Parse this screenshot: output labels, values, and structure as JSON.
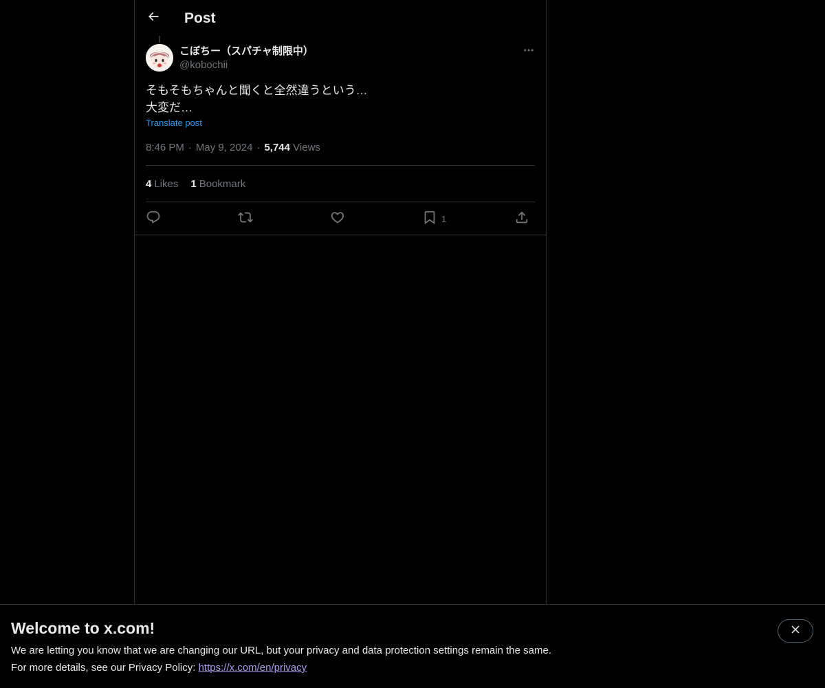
{
  "header": {
    "title": "Post"
  },
  "post": {
    "author_name": "こぼちー（スパチャ制限中）",
    "author_handle": "@kobochii",
    "text_lines": [
      "そもそもちゃんと聞くと全然違うという…",
      "大変だ…"
    ],
    "translate_label": "Translate post",
    "time": "8:46 PM",
    "date": "May 9, 2024",
    "separator": "·",
    "views_count": "5,744",
    "views_label": "Views"
  },
  "stats": {
    "likes_count": "4",
    "likes_label": "Likes",
    "bookmarks_count": "1",
    "bookmarks_label": "Bookmark"
  },
  "actions": {
    "bookmark_count": "1"
  },
  "banner": {
    "title": "Welcome to x.com!",
    "line1": "We are letting you know that we are changing our URL, but your privacy and data protection settings remain the same.",
    "line2_prefix": "For more details, see our Privacy Policy: ",
    "link_text": "https://x.com/en/privacy"
  },
  "icons": {
    "back": "arrow-left-icon",
    "more": "more-horizontal-icon",
    "reply": "reply-icon",
    "repost": "repost-icon",
    "like": "heart-icon",
    "bookmark": "bookmark-icon",
    "share": "share-icon",
    "close": "close-icon"
  },
  "colors": {
    "background": "#000000",
    "text": "#e7e9ea",
    "muted": "#71767b",
    "border": "#2f3336",
    "link": "#1d9bf0",
    "banner_link": "#a89cf0"
  }
}
